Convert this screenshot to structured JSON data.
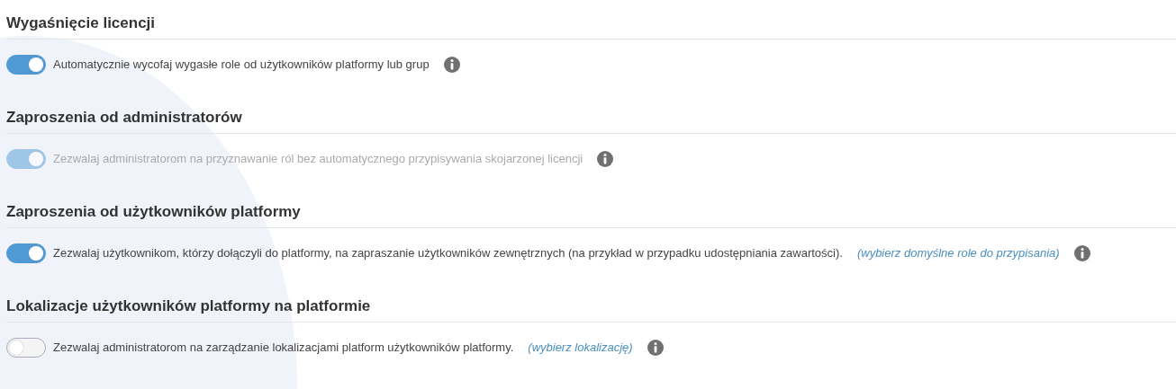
{
  "sections": [
    {
      "title": "Wygaśnięcie licencji",
      "setting": {
        "on": true,
        "disabled": false,
        "label": "Automatycznie wycofaj wygasłe role od użytkowników platformy lub grup"
      }
    },
    {
      "title": "Zaproszenia od administratorów",
      "setting": {
        "on": true,
        "disabled": true,
        "label": "Zezwalaj administratorom na przyznawanie ról bez automatycznego przypisywania skojarzonej licencji"
      }
    },
    {
      "title": "Zaproszenia od użytkowników platformy",
      "setting": {
        "on": true,
        "disabled": false,
        "label": "Zezwalaj użytkownikom, którzy dołączyli do platformy, na zapraszanie użytkowników zewnętrznych (na przykład w przypadku udostępniania zawartości).",
        "link": "(wybierz domyślne role do przypisania)"
      }
    },
    {
      "title": "Lokalizacje użytkowników platformy na platformie",
      "setting": {
        "on": false,
        "disabled": false,
        "label": "Zezwalaj administratorom na zarządzanie lokalizacjami platform użytkowników platformy.",
        "link": "(wybierz lokalizację)"
      }
    }
  ]
}
